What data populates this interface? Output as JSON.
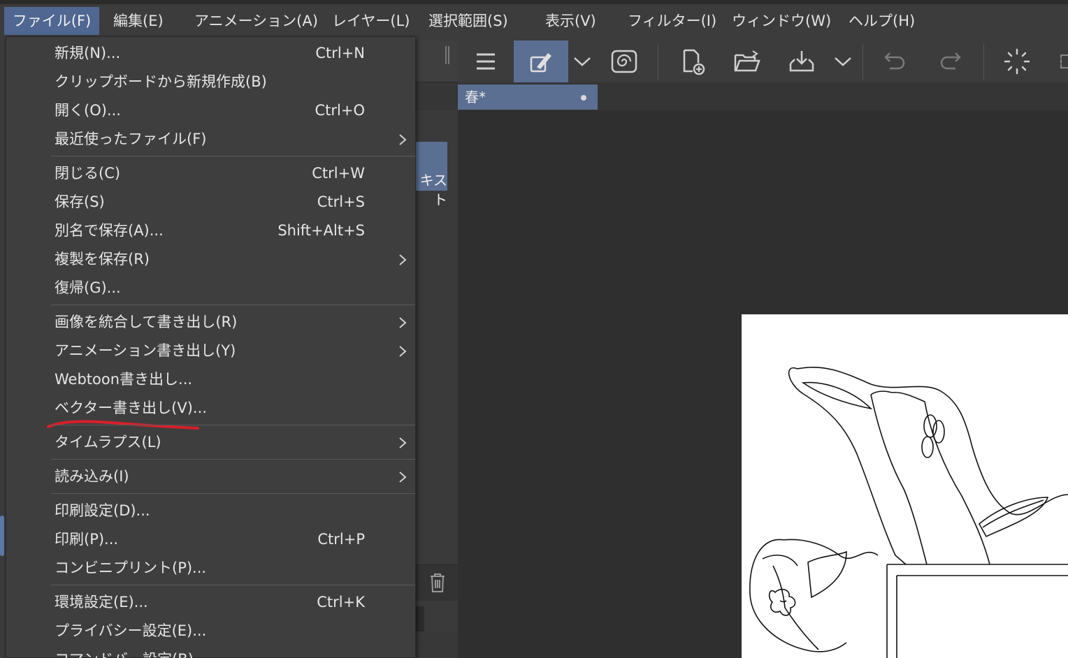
{
  "menubar": {
    "items": [
      {
        "label": "ファイル(F)"
      },
      {
        "label": "編集(E)"
      },
      {
        "label": "アニメーション(A)"
      },
      {
        "label": "レイヤー(L)"
      },
      {
        "label": "選択範囲(S)"
      },
      {
        "label": "表示(V)"
      },
      {
        "label": "フィルター(I)"
      },
      {
        "label": "ウィンドウ(W)"
      },
      {
        "label": "ヘルプ(H)"
      }
    ]
  },
  "file_menu": {
    "items": [
      {
        "label": "新規(N)...",
        "shortcut": "Ctrl+N"
      },
      {
        "label": "クリップボードから新規作成(B)",
        "shortcut": ""
      },
      {
        "label": "開く(O)...",
        "shortcut": "Ctrl+O"
      },
      {
        "label": "最近使ったファイル(F)",
        "shortcut": ""
      },
      {
        "label": "閉じる(C)",
        "shortcut": "Ctrl+W"
      },
      {
        "label": "保存(S)",
        "shortcut": "Ctrl+S"
      },
      {
        "label": "別名で保存(A)...",
        "shortcut": "Shift+Alt+S"
      },
      {
        "label": "複製を保存(R)",
        "shortcut": ""
      },
      {
        "label": "復帰(G)...",
        "shortcut": ""
      },
      {
        "label": "画像を統合して書き出し(R)",
        "shortcut": ""
      },
      {
        "label": "アニメーション書き出し(Y)",
        "shortcut": ""
      },
      {
        "label": "Webtoon書き出し...",
        "shortcut": ""
      },
      {
        "label": "ベクター書き出し(V)...",
        "shortcut": ""
      },
      {
        "label": "タイムラプス(L)",
        "shortcut": ""
      },
      {
        "label": "読み込み(I)",
        "shortcut": ""
      },
      {
        "label": "印刷設定(D)...",
        "shortcut": ""
      },
      {
        "label": "印刷(P)...",
        "shortcut": "Ctrl+P"
      },
      {
        "label": "コンビニプリント(P)...",
        "shortcut": ""
      },
      {
        "label": "環境設定(E)...",
        "shortcut": "Ctrl+K"
      },
      {
        "label": "プライバシー設定(E)...",
        "shortcut": ""
      },
      {
        "label": "コマンドバー設定(B)...",
        "shortcut": ""
      }
    ],
    "submenu_indicator": "chevron-right-icon",
    "highlight_color": "#d6202b"
  },
  "side_panel": {
    "selected_text": "キスト"
  },
  "toolbar": {
    "icons": [
      "hamburger-menu-icon",
      "pen-tool-icon",
      "chevron-down-icon",
      "spiral-icon",
      "new-file-icon",
      "open-folder-icon",
      "save-download-icon",
      "chevron-down-icon",
      "undo-icon",
      "redo-icon",
      "loading-spinner-icon"
    ]
  },
  "document_tab": {
    "title": "春*"
  },
  "colors": {
    "accent": "#5b6f93",
    "menu_active": "#4f6791",
    "menu_bg": "#3e3e3e",
    "canvas_bg": "#2f2f2f"
  }
}
